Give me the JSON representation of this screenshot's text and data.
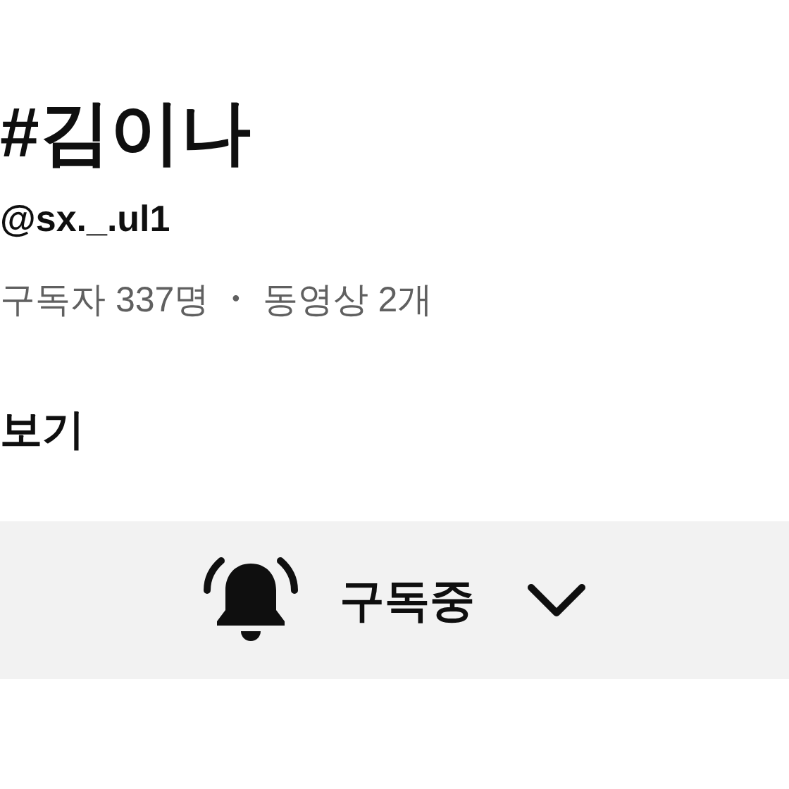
{
  "channel": {
    "name": "#김이나",
    "handle": "@sx._.ul1",
    "subscribers": "구독자 337명",
    "separator": "•",
    "videos": "동영상 2개"
  },
  "more_link": "보기",
  "subscribe_button": {
    "label": "구독중",
    "subscribed": true
  }
}
